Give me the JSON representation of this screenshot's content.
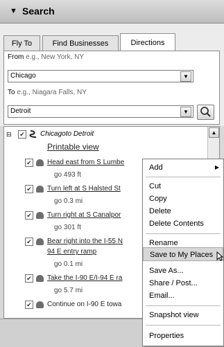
{
  "search": {
    "title": "Search",
    "tabs": [
      "Fly To",
      "Find Businesses",
      "Directions"
    ],
    "from_label": "From",
    "from_hint": " e.g., New York, NY",
    "from_value": "Chicago",
    "to_label": "To",
    "to_hint": " e.g., Niagara Falls, NY",
    "to_value": "Detroit"
  },
  "results": {
    "route_from": "Chicago",
    "route_to": "Detroit",
    "route_joiner": "to",
    "printable": "Printable view",
    "steps": [
      {
        "text": "Head east from S Lumbe",
        "dist": "go 493 ft"
      },
      {
        "text": "Turn left at S Halsted St",
        "dist": "go 0.3 mi"
      },
      {
        "text": "Turn right at S Canalpor",
        "dist": "go 301 ft"
      },
      {
        "text": "Bear right into the I-55 N",
        "text2": "94 E entry ramp",
        "dist": "go 0.1 mi"
      },
      {
        "text": "Take the I-90 E/I-94 E ra",
        "dist": "go 5.7 mi"
      },
      {
        "text": "Continue on I-90 E towa"
      }
    ]
  },
  "context_menu": {
    "items": [
      "Add",
      "Cut",
      "Copy",
      "Delete",
      "Delete Contents",
      "Rename",
      "Save to My Places",
      "Save As...",
      "Share / Post...",
      "Email...",
      "Snapshot view",
      "Properties"
    ],
    "highlighted": "Save to My Places"
  },
  "colors": {
    "highlight": "#d7d7d7",
    "panel": "#ececec"
  }
}
